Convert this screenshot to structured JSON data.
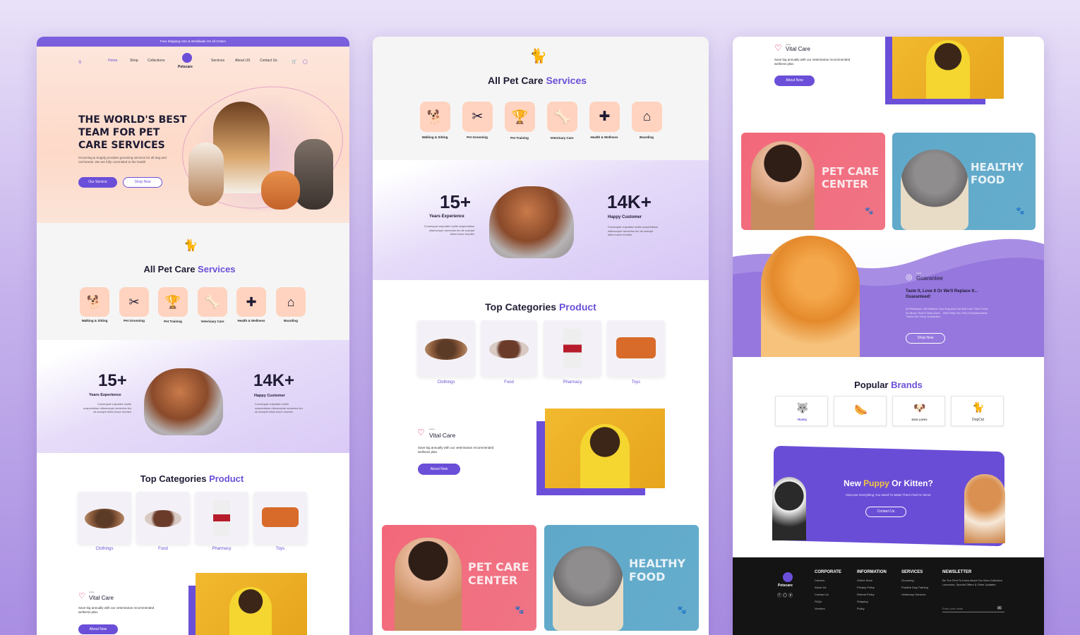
{
  "p1": {
    "topbar": "Free Shipping USA & Worldwide On All Orders",
    "nav": [
      "Home",
      "Shop",
      "Collections",
      "Services",
      "About US",
      "Contact Us"
    ],
    "logo": "Petscare",
    "hero_title": [
      "THE WORLD'S BEST",
      "TEAM FOR PET",
      "CARE SERVICES"
    ],
    "hero_text": "Grooming & Supply provides grooming services for all dog and cat breeds. We are fully committed to the health",
    "btn_service": "Our Service",
    "btn_shop": "Shop Now",
    "services_title_a": "All Pet Care ",
    "services_title_b": "Services",
    "services": [
      "Walking & Sitting",
      "Pet Grooming",
      "Pet Training",
      "Veterinary Care",
      "Health & Wellness",
      "Boarding"
    ],
    "stat1": "15+",
    "stat1_label": "Years Experience",
    "stat1_text": "Consequat vulputate mollis suspendisse ullamcorper senectus leo sit suscipit tellus fusce montes",
    "stat2": "14K+",
    "stat2_label": "Happy Customer",
    "stat2_text": "Consequat vulputate mollis suspendisse ullamcorper senectus leo sit suscipit tellus fusce montes",
    "cats_title_a": "Top Categories ",
    "cats_title_b": "Product",
    "cats": [
      "Clothings",
      "Food",
      "Pharmacy",
      "Toys"
    ],
    "vital_small": "petsa",
    "vital": "Vital Care",
    "vital_text": "Save big annually with our veterinarian recommended wellness plan.",
    "about": "About Now"
  },
  "p2": {
    "services_title_a": "All Pet Care ",
    "services_title_b": "Services",
    "services": [
      "Walking & Sitting",
      "Pet Grooming",
      "Pet Training",
      "Veterinary Care",
      "Health & Wellness",
      "Boarding"
    ],
    "stat1": "15+",
    "stat1_label": "Years Experience",
    "stat1_text": "Consequat vulputate mollis suspendisse ullamcorper senectus leo sit suscipit tellus fusce montes",
    "stat2": "14K+",
    "stat2_label": "Happy Customer",
    "stat2_text": "Consequat vulputate mollis suspendisse ullamcorper senectus leo sit suscipit tellus fusce montes",
    "cats_title_a": "Top Categories ",
    "cats_title_b": "Product",
    "cats": [
      "Clothings",
      "Food",
      "Pharmacy",
      "Toys"
    ],
    "vital_small": "petsa",
    "vital": "Vital Care",
    "vital_text": "Save big annually with our veterinarian recommended wellness plan.",
    "about": "About Now",
    "banner1": [
      "PET CARE",
      "CENTER"
    ],
    "banner2": [
      "HEALTHY",
      "FOOD"
    ]
  },
  "p3": {
    "vital_small": "petsa",
    "vital": "Vital Care",
    "vital_text": "Save big annually with our veterinarian recommended wellness plan.",
    "about": "About Now",
    "banner1": [
      "PET CARE",
      "CENTER"
    ],
    "banner2": [
      "HEALTHY",
      "FOOD"
    ],
    "guar_small": "petsa",
    "guar": "Guarantee",
    "guar_title": "Taste It, Love It Or We'll Replace It... Guaranteed!",
    "guar_text": "At Petsacare, We Believe Your Dog And Cat Will Love Their Food So Much That If They Don't... We'll Help You Find A Replacement. That's Our Furry Guarantee.",
    "shop": "Shop Now",
    "brands_title_a": "Popular ",
    "brands_title_b": "Brands",
    "brands": [
      "Husky",
      "",
      "DOG LOGO",
      "DogCat"
    ],
    "puppy_a": "New ",
    "puppy_b": "Puppy",
    "puppy_c": " Or Kitten?",
    "puppy_text": "Discover Everything You Need To Make Them Feel At Home",
    "contact": "Contact Us",
    "foot_logo": "Petscare",
    "corp_h": "CORPORATE",
    "corp": [
      "Careers",
      "About Us",
      "Contact Us",
      "FAQs",
      "Vendors"
    ],
    "info_h": "INFORMATION",
    "info": [
      "Online Store",
      "Privacy Policy",
      "Refund Policy",
      "Shipping",
      "Policy"
    ],
    "serv_h": "SERVICES",
    "serv": [
      "Grooming",
      "Positive Dog Training",
      "Veterinary Services"
    ],
    "news_h": "NEWSLETTER",
    "news_text": "Be The First To Know About Our New Collection Launches, Special Offers & Other Updates",
    "email_ph": "Enter your email"
  },
  "colors": {
    "accent": "#6b4fd8",
    "peach": "#ffd3bf",
    "dark": "#141414"
  }
}
